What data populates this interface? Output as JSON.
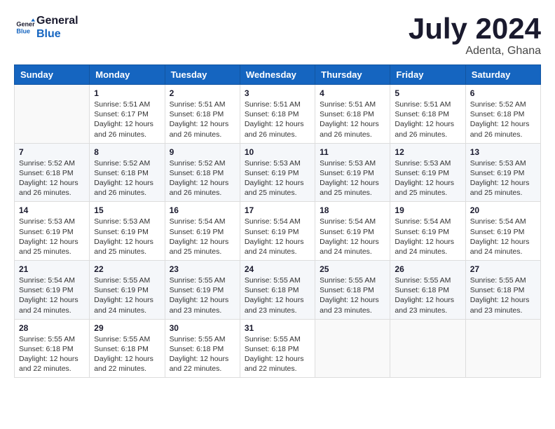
{
  "logo": {
    "line1": "General",
    "line2": "Blue"
  },
  "title": "July 2024",
  "location": "Adenta, Ghana",
  "weekdays": [
    "Sunday",
    "Monday",
    "Tuesday",
    "Wednesday",
    "Thursday",
    "Friday",
    "Saturday"
  ],
  "weeks": [
    [
      {
        "day": "",
        "sunrise": "",
        "sunset": "",
        "daylight": ""
      },
      {
        "day": "1",
        "sunrise": "Sunrise: 5:51 AM",
        "sunset": "Sunset: 6:17 PM",
        "daylight": "Daylight: 12 hours and 26 minutes."
      },
      {
        "day": "2",
        "sunrise": "Sunrise: 5:51 AM",
        "sunset": "Sunset: 6:18 PM",
        "daylight": "Daylight: 12 hours and 26 minutes."
      },
      {
        "day": "3",
        "sunrise": "Sunrise: 5:51 AM",
        "sunset": "Sunset: 6:18 PM",
        "daylight": "Daylight: 12 hours and 26 minutes."
      },
      {
        "day": "4",
        "sunrise": "Sunrise: 5:51 AM",
        "sunset": "Sunset: 6:18 PM",
        "daylight": "Daylight: 12 hours and 26 minutes."
      },
      {
        "day": "5",
        "sunrise": "Sunrise: 5:51 AM",
        "sunset": "Sunset: 6:18 PM",
        "daylight": "Daylight: 12 hours and 26 minutes."
      },
      {
        "day": "6",
        "sunrise": "Sunrise: 5:52 AM",
        "sunset": "Sunset: 6:18 PM",
        "daylight": "Daylight: 12 hours and 26 minutes."
      }
    ],
    [
      {
        "day": "7",
        "sunrise": "Sunrise: 5:52 AM",
        "sunset": "Sunset: 6:18 PM",
        "daylight": "Daylight: 12 hours and 26 minutes."
      },
      {
        "day": "8",
        "sunrise": "Sunrise: 5:52 AM",
        "sunset": "Sunset: 6:18 PM",
        "daylight": "Daylight: 12 hours and 26 minutes."
      },
      {
        "day": "9",
        "sunrise": "Sunrise: 5:52 AM",
        "sunset": "Sunset: 6:18 PM",
        "daylight": "Daylight: 12 hours and 26 minutes."
      },
      {
        "day": "10",
        "sunrise": "Sunrise: 5:53 AM",
        "sunset": "Sunset: 6:19 PM",
        "daylight": "Daylight: 12 hours and 25 minutes."
      },
      {
        "day": "11",
        "sunrise": "Sunrise: 5:53 AM",
        "sunset": "Sunset: 6:19 PM",
        "daylight": "Daylight: 12 hours and 25 minutes."
      },
      {
        "day": "12",
        "sunrise": "Sunrise: 5:53 AM",
        "sunset": "Sunset: 6:19 PM",
        "daylight": "Daylight: 12 hours and 25 minutes."
      },
      {
        "day": "13",
        "sunrise": "Sunrise: 5:53 AM",
        "sunset": "Sunset: 6:19 PM",
        "daylight": "Daylight: 12 hours and 25 minutes."
      }
    ],
    [
      {
        "day": "14",
        "sunrise": "Sunrise: 5:53 AM",
        "sunset": "Sunset: 6:19 PM",
        "daylight": "Daylight: 12 hours and 25 minutes."
      },
      {
        "day": "15",
        "sunrise": "Sunrise: 5:53 AM",
        "sunset": "Sunset: 6:19 PM",
        "daylight": "Daylight: 12 hours and 25 minutes."
      },
      {
        "day": "16",
        "sunrise": "Sunrise: 5:54 AM",
        "sunset": "Sunset: 6:19 PM",
        "daylight": "Daylight: 12 hours and 25 minutes."
      },
      {
        "day": "17",
        "sunrise": "Sunrise: 5:54 AM",
        "sunset": "Sunset: 6:19 PM",
        "daylight": "Daylight: 12 hours and 24 minutes."
      },
      {
        "day": "18",
        "sunrise": "Sunrise: 5:54 AM",
        "sunset": "Sunset: 6:19 PM",
        "daylight": "Daylight: 12 hours and 24 minutes."
      },
      {
        "day": "19",
        "sunrise": "Sunrise: 5:54 AM",
        "sunset": "Sunset: 6:19 PM",
        "daylight": "Daylight: 12 hours and 24 minutes."
      },
      {
        "day": "20",
        "sunrise": "Sunrise: 5:54 AM",
        "sunset": "Sunset: 6:19 PM",
        "daylight": "Daylight: 12 hours and 24 minutes."
      }
    ],
    [
      {
        "day": "21",
        "sunrise": "Sunrise: 5:54 AM",
        "sunset": "Sunset: 6:19 PM",
        "daylight": "Daylight: 12 hours and 24 minutes."
      },
      {
        "day": "22",
        "sunrise": "Sunrise: 5:55 AM",
        "sunset": "Sunset: 6:19 PM",
        "daylight": "Daylight: 12 hours and 24 minutes."
      },
      {
        "day": "23",
        "sunrise": "Sunrise: 5:55 AM",
        "sunset": "Sunset: 6:19 PM",
        "daylight": "Daylight: 12 hours and 23 minutes."
      },
      {
        "day": "24",
        "sunrise": "Sunrise: 5:55 AM",
        "sunset": "Sunset: 6:18 PM",
        "daylight": "Daylight: 12 hours and 23 minutes."
      },
      {
        "day": "25",
        "sunrise": "Sunrise: 5:55 AM",
        "sunset": "Sunset: 6:18 PM",
        "daylight": "Daylight: 12 hours and 23 minutes."
      },
      {
        "day": "26",
        "sunrise": "Sunrise: 5:55 AM",
        "sunset": "Sunset: 6:18 PM",
        "daylight": "Daylight: 12 hours and 23 minutes."
      },
      {
        "day": "27",
        "sunrise": "Sunrise: 5:55 AM",
        "sunset": "Sunset: 6:18 PM",
        "daylight": "Daylight: 12 hours and 23 minutes."
      }
    ],
    [
      {
        "day": "28",
        "sunrise": "Sunrise: 5:55 AM",
        "sunset": "Sunset: 6:18 PM",
        "daylight": "Daylight: 12 hours and 22 minutes."
      },
      {
        "day": "29",
        "sunrise": "Sunrise: 5:55 AM",
        "sunset": "Sunset: 6:18 PM",
        "daylight": "Daylight: 12 hours and 22 minutes."
      },
      {
        "day": "30",
        "sunrise": "Sunrise: 5:55 AM",
        "sunset": "Sunset: 6:18 PM",
        "daylight": "Daylight: 12 hours and 22 minutes."
      },
      {
        "day": "31",
        "sunrise": "Sunrise: 5:55 AM",
        "sunset": "Sunset: 6:18 PM",
        "daylight": "Daylight: 12 hours and 22 minutes."
      },
      {
        "day": "",
        "sunrise": "",
        "sunset": "",
        "daylight": ""
      },
      {
        "day": "",
        "sunrise": "",
        "sunset": "",
        "daylight": ""
      },
      {
        "day": "",
        "sunrise": "",
        "sunset": "",
        "daylight": ""
      }
    ]
  ]
}
